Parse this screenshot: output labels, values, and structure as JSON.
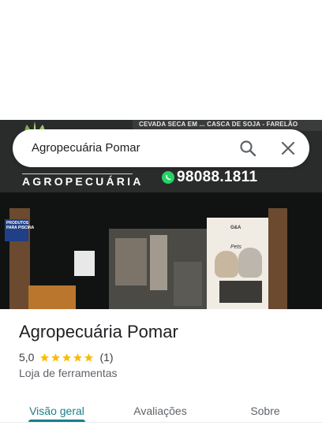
{
  "search": {
    "query": "Agropecuária Pomar"
  },
  "hero": {
    "sign_top_text": "CEVADA SECA EM ... CASCA DE SOJA - FARELÃO",
    "brand_subtitle": "AGROPECUÁRIA",
    "phone": "98088.1811",
    "box_text_1": "PRODUTOS",
    "box_text_2": "PARA PISCINA",
    "banner_logo": "G&A",
    "banner_pets": "Pets"
  },
  "place": {
    "name": "Agropecuária Pomar",
    "rating": "5,0",
    "stars": 5,
    "review_count": "(1)",
    "category": "Loja de ferramentas"
  },
  "tabs": [
    {
      "label": "Visão geral",
      "active": true
    },
    {
      "label": "Avaliações",
      "active": false
    },
    {
      "label": "Sobre",
      "active": false
    }
  ],
  "colors": {
    "accent": "#1a7f87",
    "star": "#fbbc04",
    "whatsapp": "#25d366"
  },
  "icons": [
    "search-icon",
    "close-icon",
    "star-icon",
    "whatsapp-icon",
    "leaf-logo-icon"
  ]
}
